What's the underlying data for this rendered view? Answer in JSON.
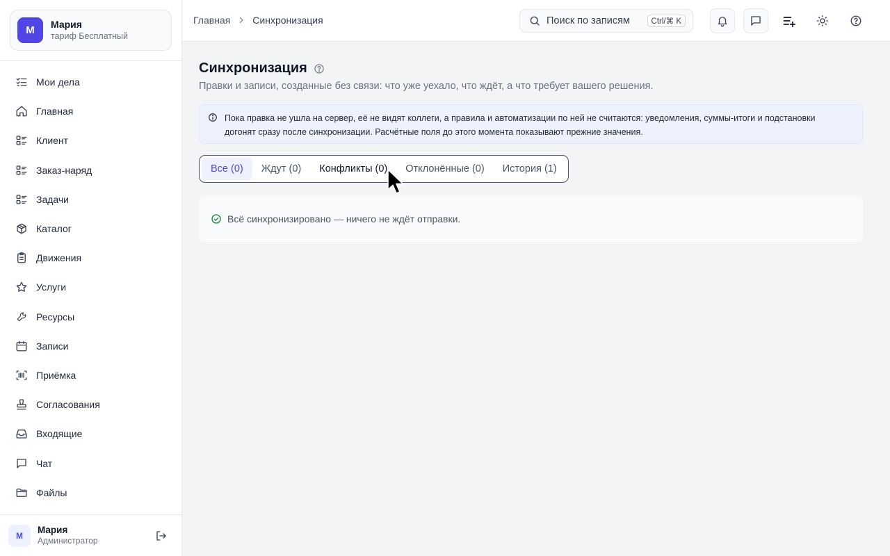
{
  "account": {
    "initial": "М",
    "name": "Мария",
    "plan": "тариф Бесплатный"
  },
  "nav": [
    {
      "label": "Мои дела",
      "icon": "checklist-icon"
    },
    {
      "label": "Главная",
      "icon": "home-icon"
    },
    {
      "label": "Клиент",
      "icon": "list-icon"
    },
    {
      "label": "Заказ-наряд",
      "icon": "list-icon"
    },
    {
      "label": "Задачи",
      "icon": "list-icon"
    },
    {
      "label": "Каталог",
      "icon": "box-icon"
    },
    {
      "label": "Движения",
      "icon": "clipboard-icon"
    },
    {
      "label": "Услуги",
      "icon": "star-icon"
    },
    {
      "label": "Ресурсы",
      "icon": "wrench-icon"
    },
    {
      "label": "Записи",
      "icon": "calendar-icon"
    },
    {
      "label": "Приёмка",
      "icon": "barcode-scan-icon"
    },
    {
      "label": "Согласования",
      "icon": "stamp-icon"
    },
    {
      "label": "Входящие",
      "icon": "inbox-icon"
    },
    {
      "label": "Чат",
      "icon": "chat-icon"
    },
    {
      "label": "Файлы",
      "icon": "folder-icon"
    }
  ],
  "user": {
    "initial": "М",
    "name": "Мария",
    "role": "Администратор"
  },
  "breadcrumb": {
    "home": "Главная",
    "current": "Синхронизация"
  },
  "search": {
    "placeholder": "Поиск по записям",
    "shortcut": "Ctrl/⌘ K"
  },
  "page": {
    "title": "Синхронизация",
    "subtitle": "Правки и записи, созданные без связи: что уже уехало, что ждёт, а что требует вашего решения.",
    "info_line1": "Пока правка не ушла на сервер, её не видят коллеги, а правила и автоматизации по ней не считаются: уведомления, суммы-итоги и подстановки",
    "info_line2": "догонят сразу после синхронизации. Расчётные поля до этого момента показывают прежние значения."
  },
  "tabs": [
    {
      "label": "Все (0)",
      "state": "active"
    },
    {
      "label": "Ждут (0)",
      "state": "normal"
    },
    {
      "label": "Конфликты (0)",
      "state": "hover"
    },
    {
      "label": "Отклонённые (0)",
      "state": "normal"
    },
    {
      "label": "История (1)",
      "state": "normal"
    }
  ],
  "empty_message": "Всё синхронизировано — ничего не ждёт отправки.",
  "colors": {
    "accent": "#4f46e5",
    "accent_bg": "#eef2ff",
    "success": "#15803d"
  }
}
